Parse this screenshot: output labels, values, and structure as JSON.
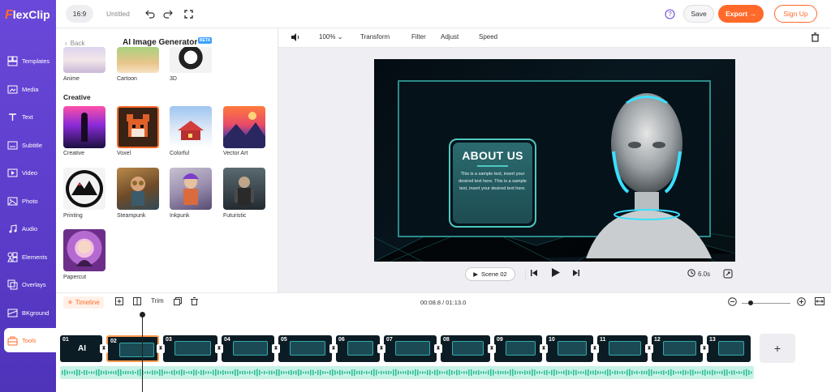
{
  "app": {
    "logo": "FlexClip"
  },
  "nav": [
    {
      "label": "Templates",
      "icon": "templates-icon"
    },
    {
      "label": "Media",
      "icon": "media-icon"
    },
    {
      "label": "Text",
      "icon": "text-icon"
    },
    {
      "label": "Subtitle",
      "icon": "subtitle-icon"
    },
    {
      "label": "Video",
      "icon": "video-icon"
    },
    {
      "label": "Photo",
      "icon": "photo-icon"
    },
    {
      "label": "Audio",
      "icon": "audio-icon"
    },
    {
      "label": "Elements",
      "icon": "elements-icon"
    },
    {
      "label": "Overlays",
      "icon": "overlays-icon"
    },
    {
      "label": "BKground",
      "icon": "background-icon"
    },
    {
      "label": "Tools",
      "icon": "tools-icon",
      "active": true
    }
  ],
  "topbar": {
    "ratio": "16:9",
    "title": "Untitled",
    "save": "Save",
    "export": "Export →",
    "signup": "Sign Up"
  },
  "panel": {
    "back": "Back",
    "title": "AI Image Generator",
    "badge": "BETA",
    "section": "Creative",
    "top_styles": [
      "Anime",
      "Cartoon",
      "3D"
    ],
    "styles": [
      "Creative",
      "Voxel",
      "Colorful",
      "Vector Art",
      "Printing",
      "Steampunk",
      "Inkpunk",
      "Futuristic",
      "Papercut"
    ]
  },
  "editor": {
    "zoom": "100%",
    "tools": [
      "Transform",
      "Filter",
      "Adjust",
      "Speed"
    ]
  },
  "scene": {
    "card_title": "ABOUT US",
    "card_body": "This is a sample text, insert your desired text here. This is a sample text, insert your desired text here."
  },
  "player": {
    "scene": "Scene 02",
    "duration": "6.0s"
  },
  "timeline": {
    "tab": "Timeline",
    "trim": "Trim",
    "time": "00:08.8 / 01:13.0",
    "clips": [
      "01",
      "02",
      "03",
      "04",
      "05",
      "06",
      "07",
      "08",
      "09",
      "10",
      "11",
      "12",
      "13"
    ],
    "clip1_text": "AI",
    "add": "+"
  },
  "colors": {
    "brand": "#6a48d9",
    "accent": "#ff6a2b",
    "teal": "#4fc8c0"
  }
}
